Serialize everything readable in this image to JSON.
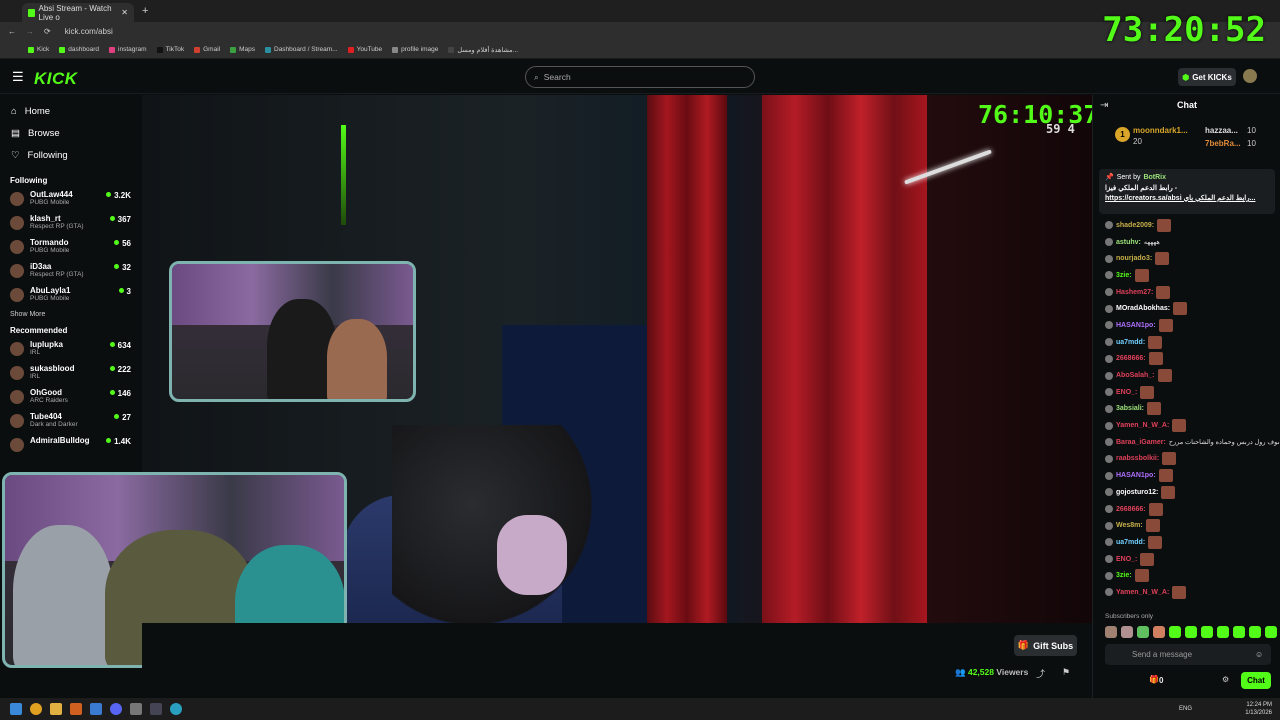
{
  "browser": {
    "tab_title": "Absi Stream - Watch Live o",
    "url": "kick.com/absi",
    "bookmarks": [
      "Kick",
      "dashboard",
      "instagram",
      "TikTok",
      "Gmail",
      "Maps",
      "Dashboard / Stream...",
      "YouTube",
      "profile image",
      "مشاهدة أفلام ومسل..."
    ]
  },
  "overlay_timer": "73:20:52",
  "header": {
    "logo": "KICK",
    "search_placeholder": "Search",
    "get_kicks": "Get KICKs"
  },
  "sidebar": {
    "nav": [
      "Home",
      "Browse",
      "Following"
    ],
    "following_title": "Following",
    "following": [
      {
        "name": "OutLaw444",
        "game": "PUBG Mobile",
        "viewers": "3.2K"
      },
      {
        "name": "klash_rt",
        "game": "Respect RP (GTA)",
        "viewers": "367"
      },
      {
        "name": "Tormando",
        "game": "PUBG Mobile",
        "viewers": "56"
      },
      {
        "name": "iD3aa",
        "game": "Respect RP (GTA)",
        "viewers": "32"
      },
      {
        "name": "AbuLayla1",
        "game": "PUBG Mobile",
        "viewers": "3"
      }
    ],
    "show_more": "Show More",
    "recommended_title": "Recommended",
    "recommended": [
      {
        "name": "luplupka",
        "game": "IRL",
        "viewers": "634"
      },
      {
        "name": "sukasblood",
        "game": "IRL",
        "viewers": "222"
      },
      {
        "name": "OhGood",
        "game": "ARC Raiders",
        "viewers": "146"
      },
      {
        "name": "Tube404",
        "game": "Dark and Darker",
        "viewers": "27"
      },
      {
        "name": "AdmiralBulldog",
        "game": "",
        "viewers": "1.4K"
      }
    ]
  },
  "video": {
    "timer": "76:10:37",
    "sub_counter": "59 4"
  },
  "stream_bar": {
    "gift_subs": "Gift Subs",
    "viewers": "42,528",
    "viewers_label": "Viewers"
  },
  "chat": {
    "title": "Chat",
    "leaders": [
      {
        "name": "moonndark1...",
        "count": "20"
      },
      {
        "name": "hazzaa...",
        "count": "10"
      },
      {
        "name": "7bebRa...",
        "count": "10"
      }
    ],
    "pinned": {
      "sent_by": "Sent by",
      "bot": "BotRix",
      "line1": "رابط الدعم الملكي فيزا -",
      "line2": "https://creators.sa/absi رابط الدعم الملكي باي..."
    },
    "messages": [
      {
        "user": "shade2009:",
        "text": "",
        "color": "#c8b04a"
      },
      {
        "user": "astuhv:",
        "text": "ههههه",
        "color": "#9be27a"
      },
      {
        "user": "nourjado3:",
        "text": "",
        "color": "#c8b04a"
      },
      {
        "user": "3zie:",
        "text": "",
        "color": "#53fc18"
      },
      {
        "user": "Hashem27:",
        "text": "",
        "color": "#e0405a"
      },
      {
        "user": "MOradAbokhas:",
        "text": "",
        "color": "#ffffff"
      },
      {
        "user": "HASAN1po:",
        "text": "",
        "color": "#b070ff"
      },
      {
        "user": "ua7mdd:",
        "text": "",
        "color": "#70d0ff"
      },
      {
        "user": "2668666:",
        "text": "",
        "color": "#e0405a"
      },
      {
        "user": "AboSalah_:",
        "text": "",
        "color": "#e0405a"
      },
      {
        "user": "ENO_:",
        "text": "",
        "color": "#e0405a"
      },
      {
        "user": "3absiali:",
        "text": "",
        "color": "#9be27a"
      },
      {
        "user": "Yamen_N_W_A:",
        "text": "",
        "color": "#e0405a"
      },
      {
        "user": "Baraa_iGamer:",
        "text": "شوف رول دربس وحماده والشاحنات مررح",
        "color": "#e0405a"
      },
      {
        "user": "raabssbolkii:",
        "text": "",
        "color": "#e0405a"
      },
      {
        "user": "HASAN1po:",
        "text": "",
        "color": "#b070ff"
      },
      {
        "user": "gojosturo12:",
        "text": "",
        "color": "#ffffff"
      },
      {
        "user": "2668666:",
        "text": "",
        "color": "#e0405a"
      },
      {
        "user": "Wes8m:",
        "text": "",
        "color": "#c8b04a"
      },
      {
        "user": "ua7mdd:",
        "text": "",
        "color": "#70d0ff"
      },
      {
        "user": "ENO_:",
        "text": "",
        "color": "#e0405a"
      },
      {
        "user": "3zie:",
        "text": "",
        "color": "#53fc18"
      },
      {
        "user": "Yamen_N_W_A:",
        "text": "",
        "color": "#e0405a"
      }
    ],
    "subscribers_only": "Subscribers only",
    "input_placeholder": "Send a message",
    "kicks_count": "0",
    "chat_button": "Chat"
  },
  "taskbar": {
    "lang": "ENG",
    "time": "12:24 PM",
    "date": "1/13/2026"
  }
}
